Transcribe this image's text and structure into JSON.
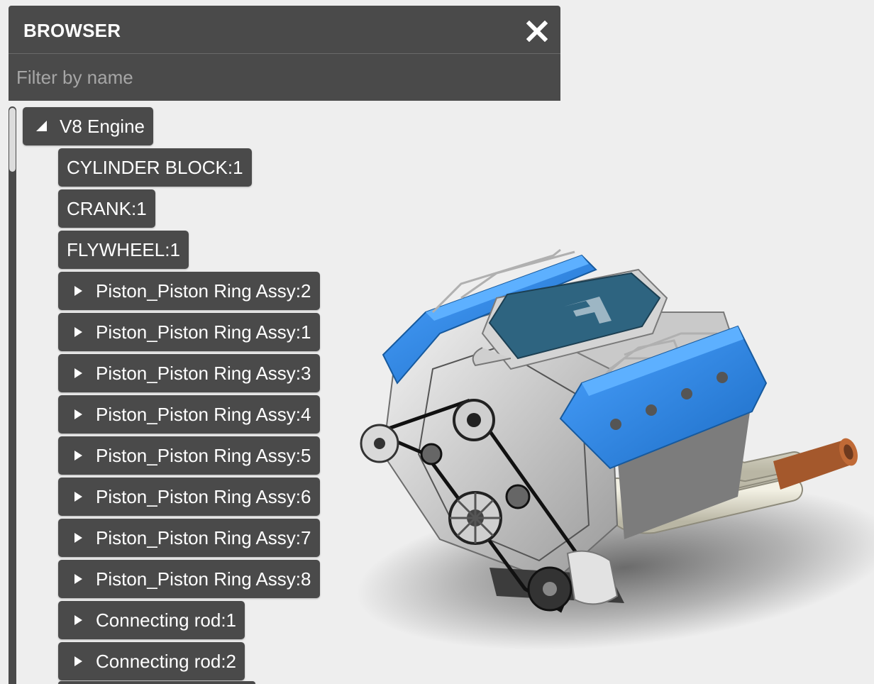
{
  "browser": {
    "title": "BROWSER",
    "close_icon": "close-icon",
    "filter_placeholder": "Filter by name",
    "filter_value": ""
  },
  "tree": {
    "root": {
      "label": "V8 Engine",
      "expanded": true
    },
    "items": [
      {
        "label": "CYLINDER BLOCK:1",
        "has_children": false
      },
      {
        "label": "CRANK:1",
        "has_children": false
      },
      {
        "label": "FLYWHEEL:1",
        "has_children": false
      },
      {
        "label": "Piston_Piston Ring Assy:2",
        "has_children": true
      },
      {
        "label": "Piston_Piston Ring Assy:1",
        "has_children": true
      },
      {
        "label": "Piston_Piston Ring Assy:3",
        "has_children": true
      },
      {
        "label": "Piston_Piston Ring Assy:4",
        "has_children": true
      },
      {
        "label": "Piston_Piston Ring Assy:5",
        "has_children": true
      },
      {
        "label": "Piston_Piston Ring Assy:6",
        "has_children": true
      },
      {
        "label": "Piston_Piston Ring Assy:7",
        "has_children": true
      },
      {
        "label": "Piston_Piston Ring Assy:8",
        "has_children": true
      },
      {
        "label": "Connecting rod:1",
        "has_children": true
      },
      {
        "label": "Connecting rod:2",
        "has_children": true
      }
    ]
  },
  "colors": {
    "panel": "#4a4a4a",
    "viewport_background": "#eeeeee",
    "valve_cover": "#2f86e0",
    "intake_plenum": "#2e6480",
    "exhaust_header": "#e8e6d8",
    "exhaust_tip": "#a4582c"
  }
}
